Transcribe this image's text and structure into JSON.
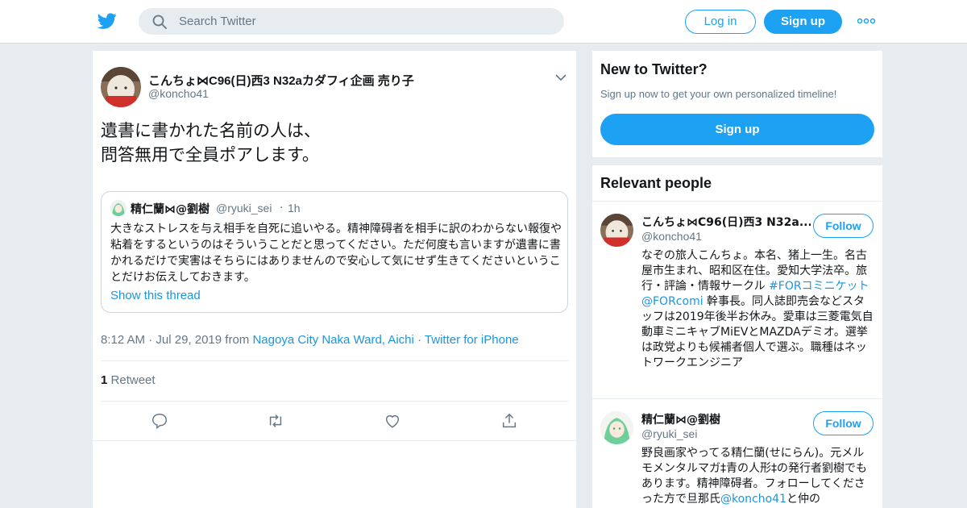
{
  "header": {
    "search_placeholder": "Search Twitter",
    "login_label": "Log in",
    "signup_label": "Sign up"
  },
  "tweet": {
    "author_name": "こんちょ⋈C96(日)西3 N32aカダフィ企画 売り子",
    "author_handle": "@koncho41",
    "text_line1": "遺書に書かれた名前の人は、",
    "text_line2": "問答無用で全員ポアします。",
    "quoted": {
      "name": "精仁蘭⋈@劉樹",
      "handle": "@ryuki_sei",
      "separator": "·",
      "time": "1h",
      "text": "大きなストレスを与え相手を自死に追いやる。精神障碍者を相手に訳のわからない報復や粘着をするというのはそういうことだと思ってください。ただ何度も言いますが遺書に書かれるだけで実害はそちらにはありませんので安心して気にせず生きてくださいということだけお伝えしておきます。",
      "show_thread": "Show this thread"
    },
    "time": "8:12 AM",
    "separator": "·",
    "date": "Jul 29, 2019",
    "from_label": "from",
    "location": "Nagoya City Naka Ward, Aichi",
    "source": "Twitter for iPhone",
    "retweet_count": "1",
    "retweet_label": "Retweet"
  },
  "sidebar": {
    "new_title": "New to Twitter?",
    "new_subtitle": "Sign up now to get your own personalized timeline!",
    "signup_label": "Sign up",
    "relevant_title": "Relevant people",
    "people": [
      {
        "name": "こんちょ⋈C96(日)西3 N32a...",
        "handle": "@koncho41",
        "follow_label": "Follow",
        "bio_a": "なぞの旅人こんちょ。本名、猪上一生。名古屋市生まれ、昭和区在住。愛知大学法卒。旅行・評論・情報サークル ",
        "bio_link1": "#FORコミニケット",
        "bio_b": " ",
        "bio_link2": "@FORcomi",
        "bio_c": " 幹事長。同人誌即売会などスタッフは2019年後半お休み。愛車は三菱電気自動車ミニキャブMiEVとMAZDAデミオ。選挙は政党よりも候補者個人で選ぶ。職種はネットワークエンジニア"
      },
      {
        "name": "精仁蘭⋈@劉樹",
        "handle": "@ryuki_sei",
        "follow_label": "Follow",
        "bio_a": "野良画家やってる精仁蘭(せにらん)。元メルモメンタルマガ‡青の人形‡の発行者劉樹でもあります。精神障碍者。フォローしてくださった方で旦那氏",
        "bio_link1": "@koncho41",
        "bio_b": "と仲の"
      }
    ]
  }
}
